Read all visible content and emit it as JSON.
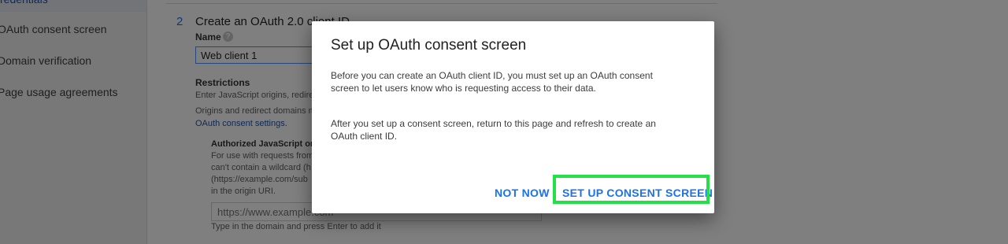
{
  "sidebar": {
    "items": [
      {
        "label": "redentials"
      },
      {
        "label": "OAuth consent screen"
      },
      {
        "label": "Domain verification"
      },
      {
        "label": "Page usage agreements"
      }
    ]
  },
  "form": {
    "step_number": "2",
    "step_title": "Create an OAuth 2.0 client ID",
    "name_label": "Name",
    "help_icon_glyph": "?",
    "name_value": "Web client 1",
    "restrictions_title": "Restrictions",
    "restrictions_line1": "Enter JavaScript origins, redire",
    "restrictions_line2": "Origins and redirect domains m",
    "consent_link": "OAuth consent settings.",
    "auth_origins_title": "Authorized JavaScript origi",
    "auth_line1": "For use with requests from",
    "auth_line2": "can't contain a wildcard (h",
    "auth_line3": "(https://example.com/sub",
    "auth_line4": "in the origin URI.",
    "origin_placeholder": "https://www.example.com",
    "origin_hint": "Type in the domain and press Enter to add it"
  },
  "dialog": {
    "title": "Set up OAuth consent screen",
    "paragraph1": "Before you can create an OAuth client ID, you must set up an OAuth consent screen to let users know who is requesting access to their data.",
    "paragraph2": "After you set up a consent screen, return to this page and refresh to create an OAuth client ID.",
    "not_now_label": "NOT NOW",
    "setup_label": "SET UP CONSENT SCREEN"
  },
  "colors": {
    "accent": "#1a73e8",
    "highlight": "#22e045",
    "scrim": "rgba(0,0,0,0.5)"
  }
}
